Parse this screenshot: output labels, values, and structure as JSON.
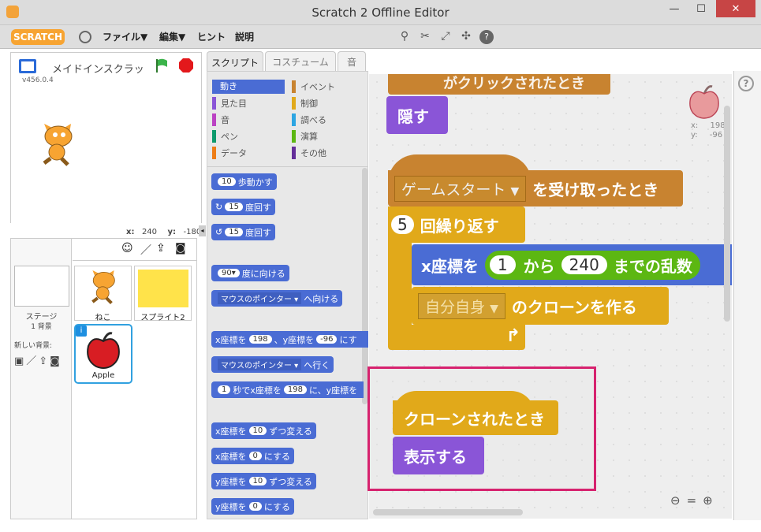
{
  "window": {
    "title": "Scratch 2 Offline Editor",
    "minimize": "—",
    "maximize": "☐",
    "close": "✕"
  },
  "menu": {
    "logo": "SCRATCH",
    "globe_icon": "globe-icon",
    "file": "ファイル▼",
    "edit": "編集▼",
    "hint": "ヒント",
    "about": "説明"
  },
  "toolbar": {
    "icons": [
      "duplicate-icon",
      "delete-icon",
      "grow-icon",
      "shrink-icon",
      "help-icon"
    ]
  },
  "stage": {
    "project_name": "メイドインスクラッ",
    "version": "v456.0.4",
    "coords_x_label": "x:",
    "coords_x": "240",
    "coords_y_label": "y:",
    "coords_y": "-180"
  },
  "sprites": {
    "stage_label": "ステージ",
    "stage_backdrops": "1 背景",
    "new_backdrop": "新しい背景:",
    "items": [
      {
        "name": "ねこ"
      },
      {
        "name": "スプライト2"
      },
      {
        "name": "Apple"
      }
    ]
  },
  "tabs": {
    "scripts": "スクリプト",
    "costumes": "コスチューム",
    "sounds": "音"
  },
  "categories": [
    {
      "name": "動き",
      "color": "#4a6cd4"
    },
    {
      "name": "イベント",
      "color": "#c88330"
    },
    {
      "name": "見た目",
      "color": "#8a55d7"
    },
    {
      "name": "制御",
      "color": "#e1a91a"
    },
    {
      "name": "音",
      "color": "#bb42c3"
    },
    {
      "name": "調べる",
      "color": "#2ca5e2"
    },
    {
      "name": "ペン",
      "color": "#0e9a6c"
    },
    {
      "name": "演算",
      "color": "#5cb712"
    },
    {
      "name": "データ",
      "color": "#ee7d16"
    },
    {
      "name": "その他",
      "color": "#632d99"
    }
  ],
  "palette": {
    "move": "歩動かす",
    "move_n": "10",
    "turn_r": "度回す",
    "turn_r_n": "15",
    "turn_l": "度回す",
    "turn_l_n": "15",
    "point_dir": "度に向ける",
    "point_dir_n": "90▾",
    "point_towards": "へ向ける",
    "point_towards_dd": "マウスのポインター ▾",
    "goto_xy_a": "x座標を",
    "goto_xy_x": "198",
    "goto_xy_b": "、y座標を",
    "goto_xy_y": "-96",
    "goto_xy_c": "にす",
    "goto": "へ行く",
    "goto_dd": "マウスのポインター ▾",
    "glide_n": "1",
    "glide_a": "秒でx座標を",
    "glide_x": "198",
    "glide_b": "に、y座標を",
    "change_x": "ずつ変える",
    "change_x_a": "x座標を",
    "change_x_n": "10",
    "set_x": "にする",
    "set_x_a": "x座標を",
    "set_x_n": "0",
    "change_y": "ずつ変える",
    "change_y_a": "y座標を",
    "change_y_n": "10",
    "set_y": "にする",
    "set_y_a": "y座標を",
    "set_y_n": "0"
  },
  "scripts": {
    "partial_hat": "がクリックされたとき",
    "hide": "隠す",
    "receive_dd": "ゲームスタート",
    "receive_txt": "を受け取ったとき",
    "repeat_n": "5",
    "repeat_txt": "回繰り返す",
    "setx_a": "x座標を",
    "rand_a": "1",
    "rand_b": "から",
    "rand_c": "240",
    "rand_d": "までの乱数",
    "clone_dd": "自分自身",
    "clone_txt": "のクローンを作る",
    "clone_hat": "クローンされたとき",
    "show": "表示する"
  },
  "sprite_info": {
    "x_label": "x:",
    "x": "198",
    "y_label": "y:",
    "y": "-96"
  },
  "highlight_color": "#d6226e"
}
